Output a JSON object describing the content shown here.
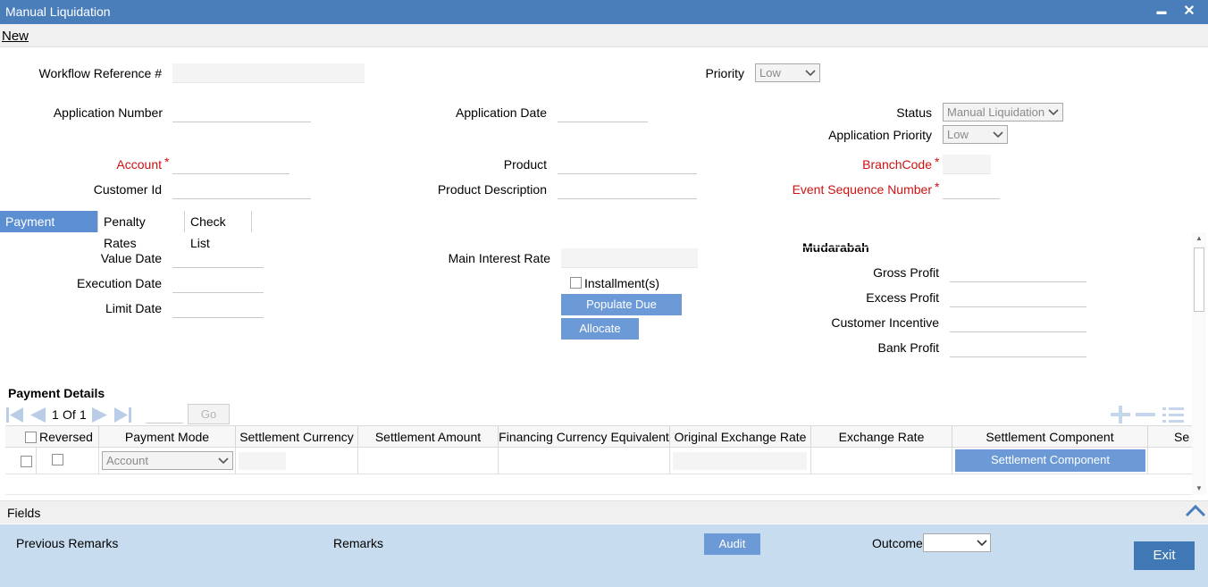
{
  "window": {
    "title": "Manual Liquidation",
    "minimize": "▬",
    "close": "✕"
  },
  "menu": {
    "new": "New"
  },
  "header": {
    "workflow_ref_label": "Workflow Reference #",
    "priority_label": "Priority",
    "priority_value": "Low",
    "application_number_label": "Application Number",
    "application_date_label": "Application Date",
    "status_label": "Status",
    "status_value": "Manual Liquidation",
    "application_priority_label": "Application Priority",
    "application_priority_value": "Low",
    "account_label": "Account",
    "product_label": "Product",
    "branchcode_label": "BranchCode",
    "customer_id_label": "Customer Id",
    "product_description_label": "Product Description",
    "event_sequence_label": "Event Sequence Number",
    "required_mark": "*"
  },
  "tabs": [
    {
      "label": "Payment Details",
      "active": true
    },
    {
      "label": "Penalty Rates",
      "active": false
    },
    {
      "label": "Check List",
      "active": false
    }
  ],
  "payment_tab": {
    "value_date_label": "Value Date",
    "execution_date_label": "Execution Date",
    "limit_date_label": "Limit Date",
    "main_interest_rate_label": "Main Interest Rate",
    "installments_label": "Installment(s)",
    "populate_due_button": "Populate Due",
    "allocate_button": "Allocate"
  },
  "mudarabah": {
    "title": "Mudarabah",
    "gross_profit_label": "Gross Profit",
    "excess_profit_label": "Excess Profit",
    "customer_incentive_label": "Customer Incentive",
    "bank_profit_label": "Bank Profit"
  },
  "payment_grid": {
    "title": "Payment Details",
    "page_current": "1",
    "page_of": "Of",
    "page_total": "1",
    "go_button": "Go",
    "columns": [
      "Reversed",
      "Payment Mode",
      "Settlement Currency",
      "Settlement Amount",
      "Financing Currency Equivalent",
      "Original Exchange Rate",
      "Exchange Rate",
      "Settlement Component",
      "Se"
    ],
    "rows": [
      {
        "payment_mode": "Account",
        "settlement_component_button": "Settlement Component"
      }
    ]
  },
  "fields_bar": {
    "label": "Fields"
  },
  "footer": {
    "previous_remarks": "Previous Remarks",
    "remarks": "Remarks",
    "audit_button": "Audit",
    "outcome_label": "Outcome",
    "exit_button": "Exit"
  },
  "colors": {
    "titlebar": "#4a7ebb",
    "accent": "#6b9ad6",
    "required": "#cc1111",
    "footer": "#c7dcee",
    "exit": "#3f78b4"
  }
}
